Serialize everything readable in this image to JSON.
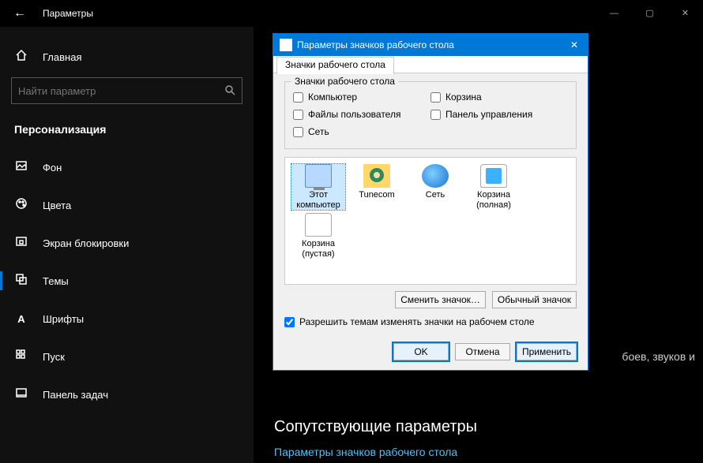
{
  "titlebar": {
    "title": "Параметры"
  },
  "sidebar": {
    "home": "Главная",
    "search_placeholder": "Найти параметр",
    "section": "Персонализация",
    "items": [
      {
        "label": "Фон",
        "icon": "picture-icon"
      },
      {
        "label": "Цвета",
        "icon": "palette-icon"
      },
      {
        "label": "Экран блокировки",
        "icon": "lock-screen-icon"
      },
      {
        "label": "Темы",
        "icon": "themes-icon",
        "active": true
      },
      {
        "label": "Шрифты",
        "icon": "font-icon"
      },
      {
        "label": "Пуск",
        "icon": "start-icon"
      },
      {
        "label": "Панель задач",
        "icon": "taskbar-icon"
      }
    ]
  },
  "main": {
    "body_fragment": "боев, звуков и",
    "related_header": "Сопутствующие параметры",
    "related_link": "Параметры значков рабочего стола"
  },
  "dialog": {
    "title": "Параметры значков рабочего стола",
    "tab": "Значки рабочего стола",
    "group_label": "Значки рабочего стола",
    "checks": {
      "computer": "Компьютер",
      "recycle": "Корзина",
      "userfiles": "Файлы пользователя",
      "controlpanel": "Панель управления",
      "network": "Сеть"
    },
    "icons": [
      {
        "label": "Этот компьютер",
        "kind": "computer"
      },
      {
        "label": "Tunecom",
        "kind": "folder"
      },
      {
        "label": "Сеть",
        "kind": "net"
      },
      {
        "label": "Корзина (полная)",
        "kind": "binf"
      },
      {
        "label": "Корзина (пустая)",
        "kind": "bine"
      }
    ],
    "change_btn": "Сменить значок…",
    "default_btn": "Обычный значок",
    "allow_themes": "Разрешить темам изменять значки на рабочем столе",
    "ok": "OK",
    "cancel": "Отмена",
    "apply": "Применить"
  }
}
